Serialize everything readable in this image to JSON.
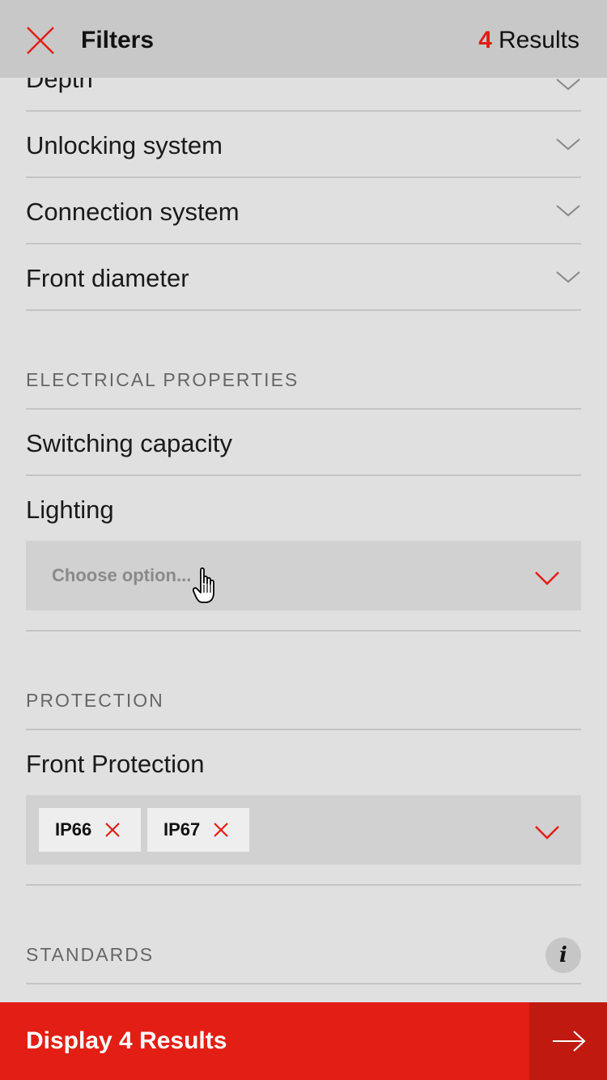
{
  "header": {
    "title": "Filters",
    "results_count": "4",
    "results_label": "Results"
  },
  "filters_top": [
    {
      "label": "Depth"
    },
    {
      "label": "Unlocking system"
    },
    {
      "label": "Connection system"
    },
    {
      "label": "Front diameter"
    }
  ],
  "electrical": {
    "heading": "ELECTRICAL PROPERTIES",
    "switching_label": "Switching capacity",
    "lighting_label": "Lighting",
    "lighting_placeholder": "Choose option..."
  },
  "protection": {
    "heading": "PROTECTION",
    "front_label": "Front Protection",
    "tags": [
      "IP66",
      "IP67"
    ]
  },
  "standards": {
    "heading": "STANDARDS",
    "info_glyph": "i"
  },
  "footer": {
    "label": "Display 4 Results"
  },
  "colors": {
    "accent": "#e31e14",
    "accent_dark": "#c01a10",
    "background": "#e0e0e0",
    "header_bg": "#c8c8c8",
    "select_bg": "#d1d1d1"
  }
}
